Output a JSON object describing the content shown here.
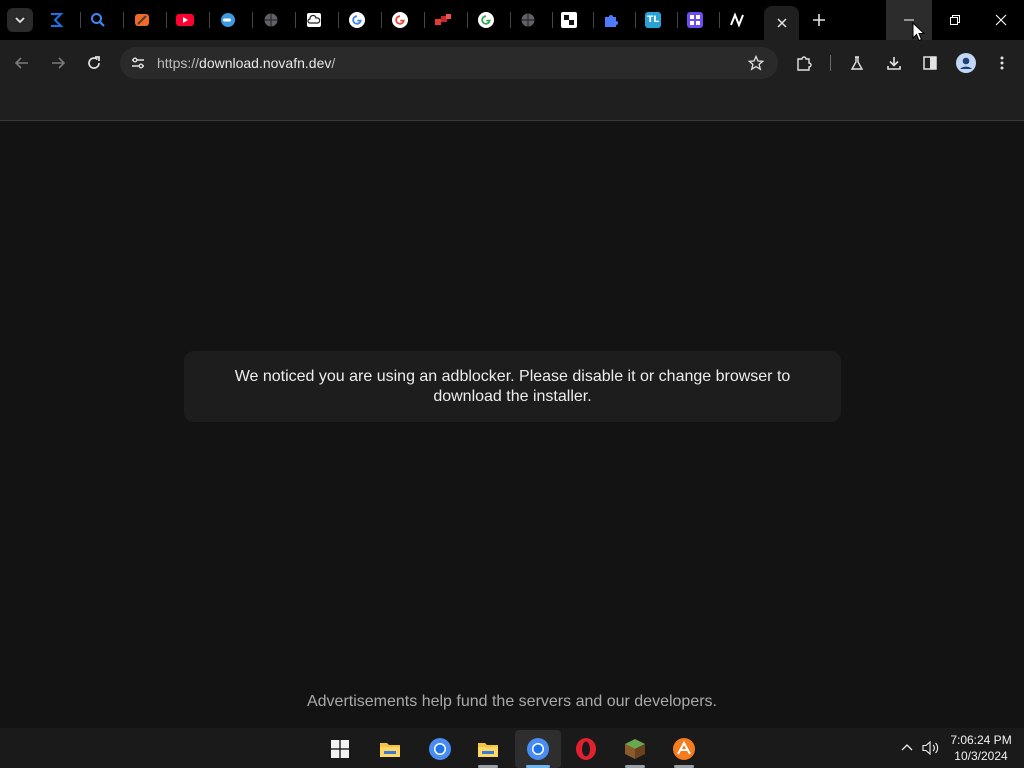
{
  "browser": {
    "tabs": [
      {
        "icon": "hourglass-sigma-icon",
        "color": "#1a73e8"
      },
      {
        "icon": "search-magnifier-icon",
        "color": "#4285f4"
      },
      {
        "icon": "colorful-art-icon",
        "color": "#f06b2a"
      },
      {
        "icon": "youtube-icon",
        "color": "#ff0033"
      },
      {
        "icon": "blue-pill-icon",
        "color": "#3b9ae1"
      },
      {
        "icon": "globe-icon",
        "color": "#9e9e9e"
      },
      {
        "icon": "cloud-icon",
        "color": "#ffffff"
      },
      {
        "icon": "google-icon",
        "color": "#ffffff"
      },
      {
        "icon": "google-icon",
        "color": "#ffffff"
      },
      {
        "icon": "red-shapes-icon",
        "color": "#e53935"
      },
      {
        "icon": "google-icon",
        "color": "#ffffff"
      },
      {
        "icon": "globe-icon",
        "color": "#9e9e9e"
      },
      {
        "icon": "shield-logo-icon",
        "color": "#ffffff"
      },
      {
        "icon": "extension-puzzle-icon",
        "color": "#4f7cff"
      },
      {
        "icon": "tl-logo-icon",
        "color": "#29a3d6",
        "text": "TL"
      },
      {
        "icon": "purple-grid-icon",
        "color": "#6c4cf5"
      },
      {
        "icon": "nova-logo-icon",
        "color": "#ffffff"
      }
    ],
    "active_tab": {
      "icon": "close-icon"
    },
    "omnibox": {
      "url_scheme": "https://",
      "url_host": "download.novafn.dev",
      "url_path": "/"
    }
  },
  "page": {
    "notice_text": "We noticed you are using an adblocker. Please disable it or change browser to download the installer.",
    "footer_text": "Advertisements help fund the servers and our developers."
  },
  "taskbar": {
    "apps": [
      {
        "name": "windows-start"
      },
      {
        "name": "file-explorer"
      },
      {
        "name": "chrome"
      },
      {
        "name": "file-explorer-2"
      },
      {
        "name": "chrome-active"
      },
      {
        "name": "opera"
      },
      {
        "name": "minecraft"
      },
      {
        "name": "app-orange"
      }
    ],
    "clock": {
      "time": "7:06:24 PM",
      "date": "10/3/2024"
    }
  },
  "colors": {
    "page_bg": "#131313",
    "toolbar_bg": "#1f1f1f",
    "notice_bg": "#1d1d1d",
    "accent": "#6fb6f2"
  }
}
